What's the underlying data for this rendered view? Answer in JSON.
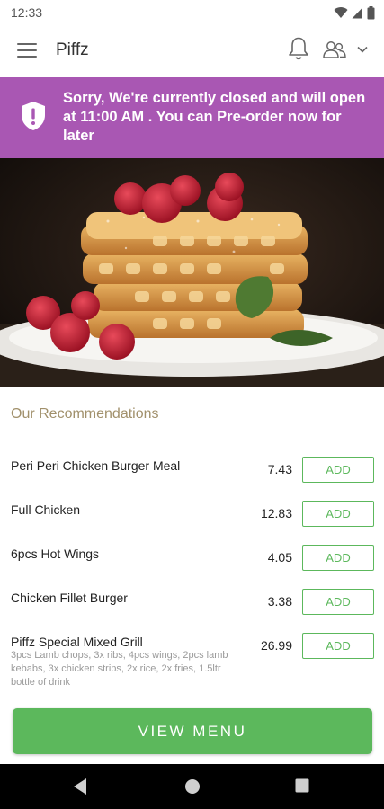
{
  "status_bar": {
    "time": "12:33"
  },
  "app_bar": {
    "title": "Piffz"
  },
  "banner": {
    "message": "Sorry, We're currently closed and will open at 11:00 AM . You can Pre-order now for later",
    "color": "#a957b3"
  },
  "recommendations": {
    "title": "Our Recommendations",
    "items": [
      {
        "name": "Peri Peri Chicken Burger Meal",
        "price": "7.43",
        "add_label": "ADD"
      },
      {
        "name": "Full Chicken",
        "price": "12.83",
        "add_label": "ADD"
      },
      {
        "name": "6pcs Hot Wings",
        "price": "4.05",
        "add_label": "ADD"
      },
      {
        "name": "Chicken Fillet Burger",
        "price": "3.38",
        "add_label": "ADD"
      },
      {
        "name": "Piffz Special Mixed Grill",
        "price": "26.99",
        "add_label": "ADD",
        "description": "3pcs Lamb chops, 3x ribs, 4pcs wings, 2pcs lamb kebabs, 3x chicken strips, 2x rice, 2x fries, 1.5ltr bottle of drink"
      }
    ]
  },
  "footer": {
    "view_menu_label": "VIEW MENU"
  },
  "colors": {
    "accent_green": "#5cb85c",
    "banner_purple": "#a957b3",
    "section_title": "#a1906b"
  },
  "icons": [
    "menu-icon",
    "bell-icon",
    "user-icon",
    "chevron-down-icon",
    "shield-icon",
    "back-icon",
    "home-icon",
    "recents-icon"
  ]
}
